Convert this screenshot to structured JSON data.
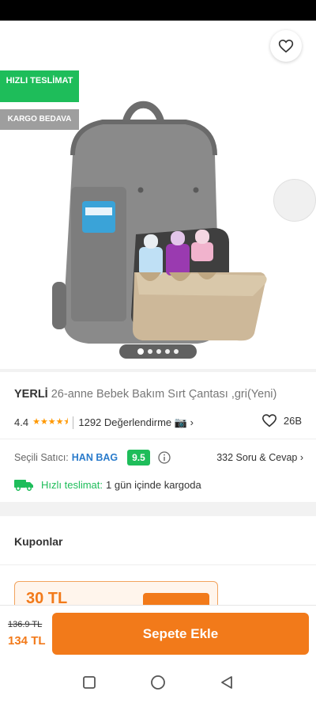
{
  "badges": {
    "fast_delivery": "HIZLI TESLİMAT",
    "free_cargo": "KARGO BEDAVA"
  },
  "product": {
    "brand": "YERLİ",
    "name": "26-anne Bebek Bakım Sırt Çantası ,gri(Yeni)",
    "rating": "4.4",
    "stars": "★★★★⯨",
    "reviews": "1292 Değerlendirme 📷 ›",
    "favorites": "26B"
  },
  "seller": {
    "label": "Seçili Satıcı:",
    "name": "HAN BAG",
    "score": "9.5",
    "qa": "332 Soru & Cevap ›"
  },
  "delivery": {
    "label": "Hızlı teslimat:",
    "value": "1 gün içinde kargoda"
  },
  "coupons": {
    "title": "Kuponlar",
    "amount": "30 TL"
  },
  "price": {
    "old": "136.9 TL",
    "new": "134 TL"
  },
  "cart": {
    "label": "Sepete Ekle"
  },
  "carousel": {
    "total": 5,
    "active": 1
  },
  "colors": {
    "accent": "#f27a1a",
    "green": "#1ebd5a",
    "link": "#2a7bcb"
  }
}
